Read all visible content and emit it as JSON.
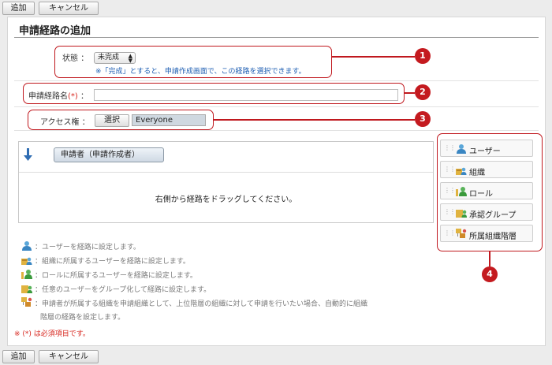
{
  "toolbar": {
    "add_label": "追加",
    "cancel_label": "キャンセル"
  },
  "page_title": "申請経路の追加",
  "form": {
    "status_label": "状態",
    "status_value": "未完成",
    "status_note": "※「完成」とすると、申請作成画面で、この経路を選択できます。",
    "route_name_label": "申請経路名",
    "route_name_required_mark": "(*)",
    "route_name_value": "",
    "access_label": "アクセス権",
    "colon": "：",
    "select_button": "選択",
    "access_value": "Everyone"
  },
  "route": {
    "applicant_label": "申請者（申請作成者）",
    "drag_message": "右側から経路をドラッグしてください。"
  },
  "palette": {
    "items": [
      {
        "label": "ユーザー",
        "icon": "user-icon"
      },
      {
        "label": "組織",
        "icon": "organization-icon"
      },
      {
        "label": "ロール",
        "icon": "role-icon"
      },
      {
        "label": "承認グループ",
        "icon": "approval-group-icon"
      },
      {
        "label": "所属組織階層",
        "icon": "org-hierarchy-icon"
      }
    ]
  },
  "legend": {
    "items": [
      "：ユーザーを経路に設定します。",
      "：組織に所属するユーザーを経路に設定します。",
      "：ロールに所属するユーザーを経路に設定します。",
      "：任意のユーザーをグループ化して経路に設定します。",
      "：申請者が所属する組織を申請組織として、上位階層の組織に対して申請を行いたい場合、自動的に組織"
    ],
    "continuation": "階層の経路を設定します。"
  },
  "required_note": "※ (*) は必須項目です。",
  "callouts": [
    "1",
    "2",
    "3",
    "4"
  ],
  "colors": {
    "callout": "#c0181e",
    "note_blue": "#1f5fb3",
    "required_red": "#d7261e"
  }
}
